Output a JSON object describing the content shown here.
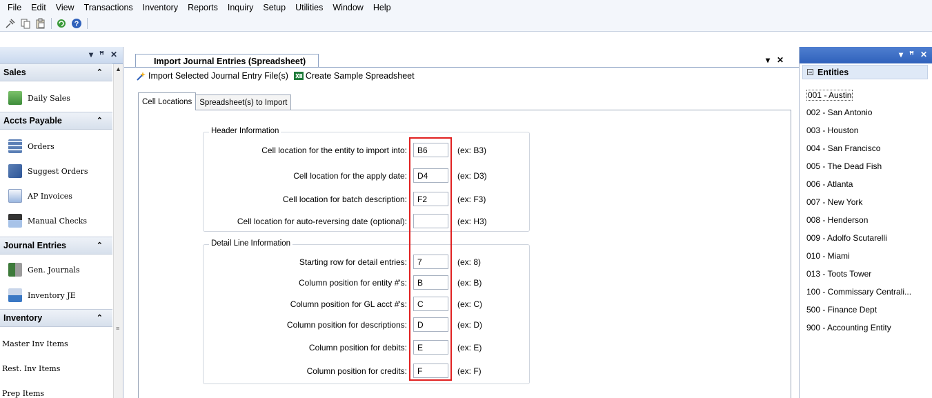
{
  "menu": [
    "File",
    "Edit",
    "View",
    "Transactions",
    "Inventory",
    "Reports",
    "Inquiry",
    "Setup",
    "Utilities",
    "Window",
    "Help"
  ],
  "toolbar_icons": [
    "pin-icon",
    "copy-icon",
    "paste-icon",
    "refresh-icon",
    "help-icon"
  ],
  "left_panel": {
    "controls": [
      "▾",
      "ꟸ",
      "✕"
    ],
    "sections": [
      {
        "title": "Sales",
        "items": [
          {
            "label": "Daily Sales",
            "icon": "daily-sales-icon"
          }
        ]
      },
      {
        "title": "Accts Payable",
        "items": [
          {
            "label": "Orders",
            "icon": "orders-icon"
          },
          {
            "label": "Suggest Orders",
            "icon": "suggest-orders-icon"
          },
          {
            "label": "AP Invoices",
            "icon": "ap-invoices-icon"
          },
          {
            "label": "Manual Checks",
            "icon": "manual-checks-icon"
          }
        ]
      },
      {
        "title": "Journal Entries",
        "items": [
          {
            "label": "Gen. Journals",
            "icon": "gen-journals-icon"
          },
          {
            "label": "Inventory JE",
            "icon": "inventory-je-icon"
          }
        ]
      },
      {
        "title": "Inventory",
        "items": [
          {
            "label": "Master Inv Items"
          },
          {
            "label": "Rest. Inv Items"
          },
          {
            "label": "Prep Items"
          }
        ]
      }
    ]
  },
  "document": {
    "tab_title": "Import Journal Entries (Spreadsheet)",
    "actions": {
      "import": "Import Selected Journal Entry File(s)",
      "sample": "Create Sample Spreadsheet"
    },
    "tabs": [
      "Cell Locations",
      "Spreadsheet(s) to Import"
    ],
    "header_group": {
      "title": "Header Information",
      "rows": [
        {
          "label": "Cell location for the entity to import into:",
          "value": "B6",
          "example": "(ex: B3)"
        },
        {
          "label": "Cell location for the apply date:",
          "value": "D4",
          "example": "(ex: D3)"
        },
        {
          "label": "Cell location for batch description:",
          "value": "F2",
          "example": "(ex: F3)"
        },
        {
          "label": "Cell location for auto-reversing date (optional):",
          "value": "",
          "example": "(ex: H3)"
        }
      ]
    },
    "detail_group": {
      "title": "Detail Line Information",
      "rows": [
        {
          "label": "Starting row for detail entries:",
          "value": "7",
          "example": "(ex: 8)"
        },
        {
          "label": "Column position for entity #'s:",
          "value": "B",
          "example": "(ex: B)"
        },
        {
          "label": "Column position for GL acct #'s:",
          "value": "C",
          "example": "(ex: C)"
        },
        {
          "label": "Column position for descriptions:",
          "value": "D",
          "example": "(ex: D)"
        },
        {
          "label": "Column position for debits:",
          "value": "E",
          "example": "(ex: E)"
        },
        {
          "label": "Column position for credits:",
          "value": "F",
          "example": "(ex: F)"
        }
      ]
    }
  },
  "entities": {
    "title": "Entities",
    "items": [
      "001 - Austin",
      "002 - San Antonio",
      "003 - Houston",
      "004 - San Francisco",
      "005 - The Dead Fish",
      "006 - Atlanta",
      "007 - New York",
      "008 - Henderson",
      "009 - Adolfo Scutarelli",
      "010 - Miami",
      "013 - Toots Tower",
      "100 - Commissary Centrali...",
      "500 - Finance Dept",
      "900 - Accounting Entity"
    ],
    "selected_index": 0
  },
  "colors": {
    "highlight": "#e02020",
    "accent": "#2f61bb"
  }
}
